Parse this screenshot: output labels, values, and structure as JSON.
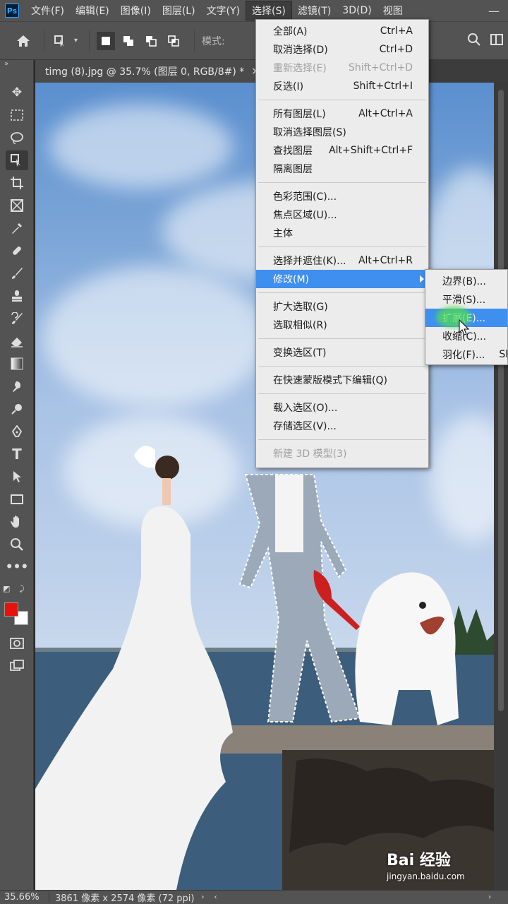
{
  "app": {
    "logo": "Ps"
  },
  "menubar": [
    "文件(F)",
    "编辑(E)",
    "图像(I)",
    "图层(L)",
    "文字(Y)",
    "选择(S)",
    "滤镜(T)",
    "3D(D)",
    "视图"
  ],
  "menubar_active": "选择(S)",
  "options": {
    "mode_label": "模式:"
  },
  "doc_tab": {
    "title": "timg (8).jpg @ 35.7% (图层 0, RGB/8#) *",
    "close": "×"
  },
  "tools": [
    "move-icon",
    "marquee-icon",
    "lasso-icon",
    "quick-select-icon",
    "crop-icon",
    "frame-icon",
    "eyedropper-icon",
    "healing-icon",
    "brush-icon",
    "stamp-icon",
    "history-brush-icon",
    "eraser-icon",
    "gradient-icon",
    "smudge-icon",
    "dodge-icon",
    "pen-icon",
    "type-icon",
    "path-select-icon",
    "rectangle-icon",
    "hand-icon",
    "zoom-icon",
    "more-icon"
  ],
  "colors": {
    "foreground": "#e8120b",
    "background": "#ffffff",
    "accent": "#3f8fef"
  },
  "select_menu": {
    "g1": [
      {
        "label": "全部(A)",
        "shortcut": "Ctrl+A"
      },
      {
        "label": "取消选择(D)",
        "shortcut": "Ctrl+D"
      },
      {
        "label": "重新选择(E)",
        "shortcut": "Shift+Ctrl+D"
      },
      {
        "label": "反选(I)",
        "shortcut": "Shift+Ctrl+I"
      }
    ],
    "g2": [
      {
        "label": "所有图层(L)",
        "shortcut": "Alt+Ctrl+A"
      },
      {
        "label": "取消选择图层(S)",
        "shortcut": ""
      },
      {
        "label": "查找图层",
        "shortcut": "Alt+Shift+Ctrl+F"
      },
      {
        "label": "隔离图层",
        "shortcut": ""
      }
    ],
    "g3": [
      {
        "label": "色彩范围(C)...",
        "shortcut": ""
      },
      {
        "label": "焦点区域(U)...",
        "shortcut": ""
      },
      {
        "label": "主体",
        "shortcut": ""
      }
    ],
    "g4": [
      {
        "label": "选择并遮住(K)...",
        "shortcut": "Alt+Ctrl+R"
      },
      {
        "label": "修改(M)",
        "shortcut": ""
      }
    ],
    "g5": [
      {
        "label": "扩大选取(G)",
        "shortcut": ""
      },
      {
        "label": "选取相似(R)",
        "shortcut": ""
      }
    ],
    "g6": [
      {
        "label": "变换选区(T)",
        "shortcut": ""
      }
    ],
    "g7": [
      {
        "label": "在快速蒙版模式下编辑(Q)",
        "shortcut": ""
      }
    ],
    "g8": [
      {
        "label": "载入选区(O)...",
        "shortcut": ""
      },
      {
        "label": "存储选区(V)...",
        "shortcut": ""
      }
    ],
    "g9": [
      {
        "label": "新建 3D 模型(3)",
        "shortcut": ""
      }
    ]
  },
  "modify_submenu": [
    {
      "label": "边界(B)..."
    },
    {
      "label": "平滑(S)..."
    },
    {
      "label": "扩展(E)..."
    },
    {
      "label": "收缩(C)..."
    },
    {
      "label": "羽化(F)..."
    }
  ],
  "submenu_overflow": "Sh",
  "status": {
    "zoom": "35.66%",
    "dims": "3861 像素 x 2574 像素 (72 ppi)"
  },
  "watermark": {
    "brand": "Bai 经验",
    "url": "jingyan.baidu.com"
  }
}
